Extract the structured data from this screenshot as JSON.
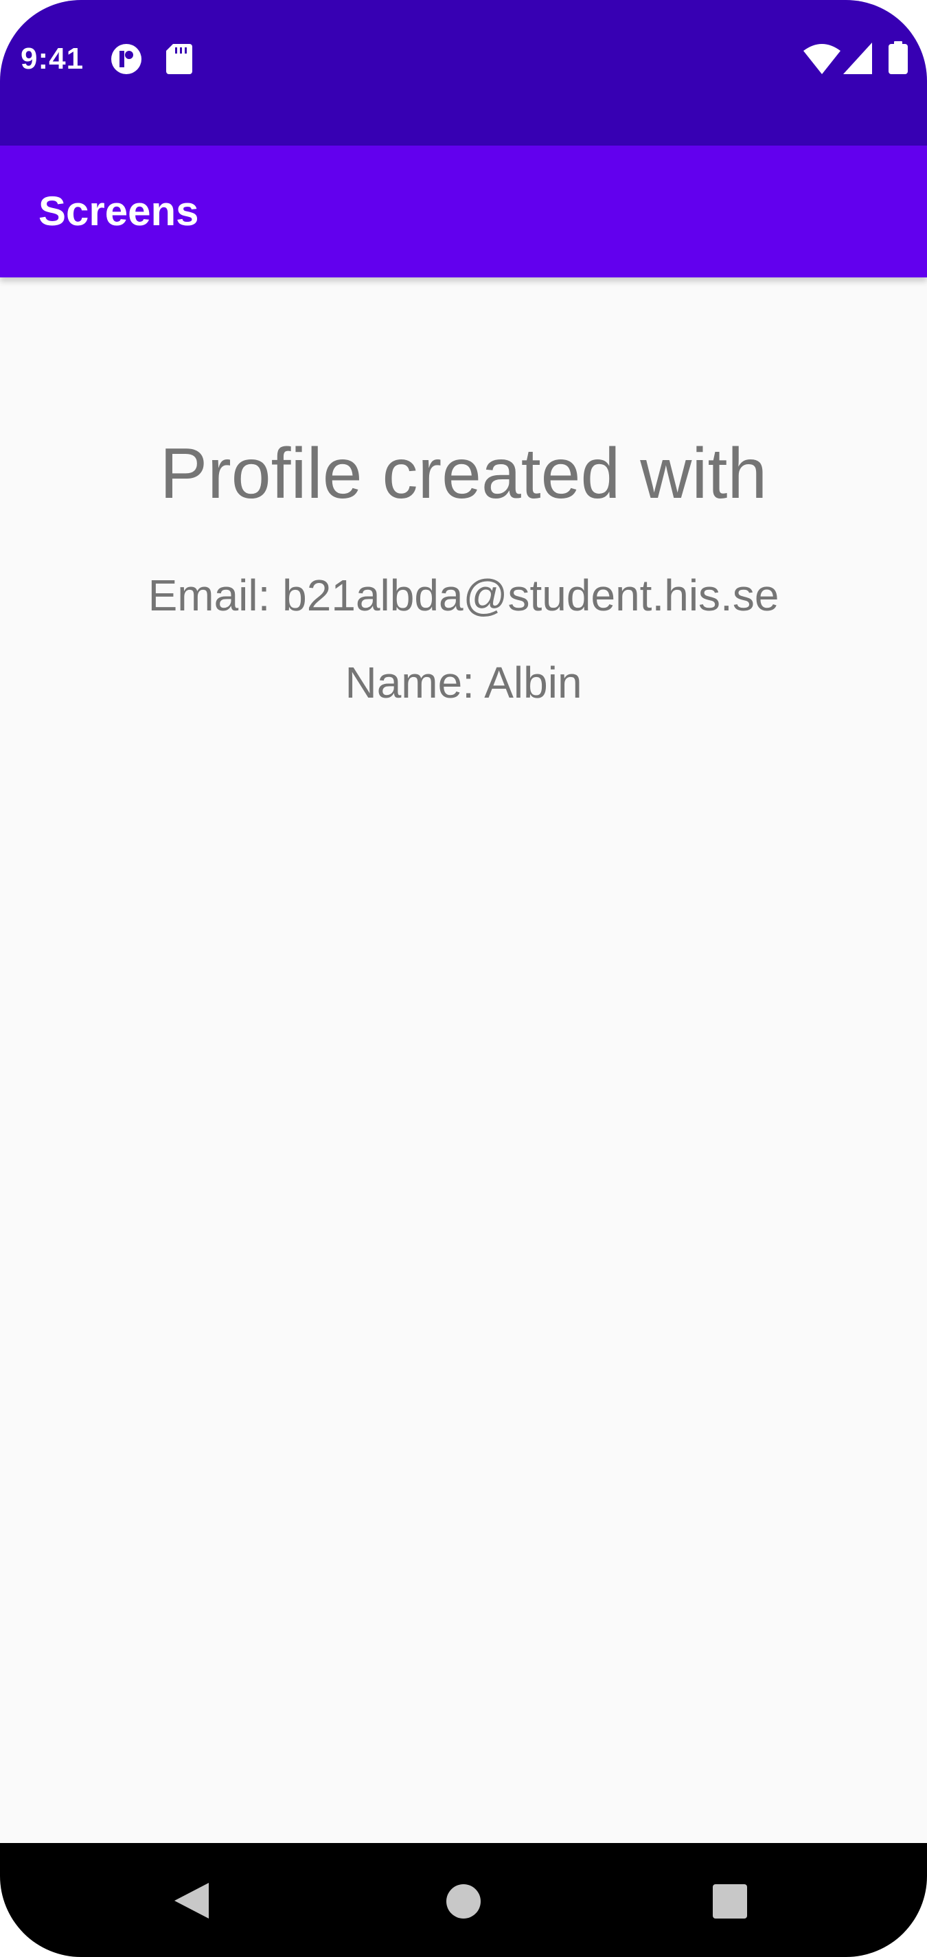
{
  "status_bar": {
    "time": "9:41",
    "background_color": "#3700b3",
    "icons": [
      "notification-icon",
      "sd-card-icon",
      "wifi-icon",
      "cellular-signal-icon",
      "battery-icon"
    ]
  },
  "app_bar": {
    "title": "Screens",
    "background_color": "#6200ee"
  },
  "main": {
    "headline": "Profile created with",
    "email_line": "Email: b21albda@student.his.se",
    "name_line": "Name: Albin"
  },
  "nav_bar": {
    "buttons": [
      "back-icon",
      "home-icon",
      "recents-icon"
    ]
  }
}
